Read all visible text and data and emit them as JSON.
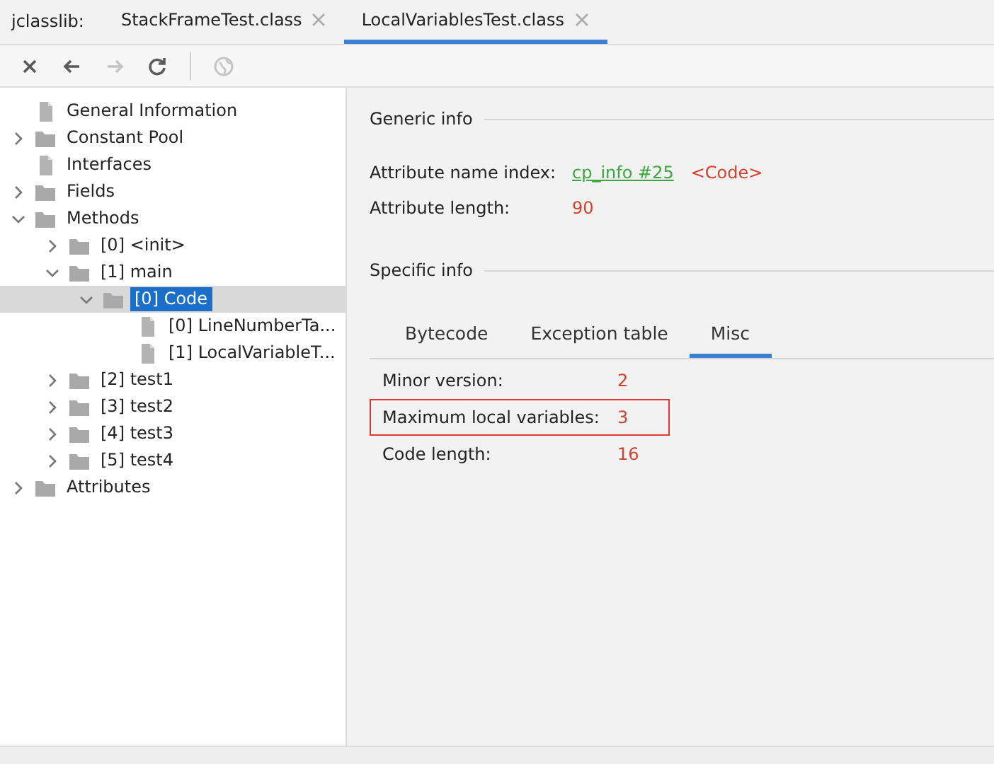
{
  "title_bar": {
    "app_label": "jclasslib:",
    "tabs": [
      {
        "label": "StackFrameTest.class",
        "selected": false
      },
      {
        "label": "LocalVariablesTest.class",
        "selected": true
      }
    ]
  },
  "toolbar": [
    {
      "kind": "close",
      "disabled": false
    },
    {
      "kind": "back",
      "disabled": false
    },
    {
      "kind": "forward",
      "disabled": true
    },
    {
      "kind": "refresh",
      "disabled": false
    },
    {
      "kind": "web",
      "disabled": true
    }
  ],
  "tree": [
    {
      "label": "General Information",
      "kind": "file",
      "selected": false
    },
    {
      "label": "Constant Pool",
      "kind": "folder",
      "expanded": false,
      "selected": false
    },
    {
      "label": "Interfaces",
      "kind": "file",
      "selected": false
    },
    {
      "label": "Fields",
      "kind": "folder",
      "expanded": false,
      "selected": false
    },
    {
      "label": "Methods",
      "kind": "folder",
      "expanded": true,
      "selected": false,
      "children": [
        {
          "label": "[0] <init>",
          "kind": "folder",
          "expanded": false,
          "selected": false
        },
        {
          "label": "[1] main",
          "kind": "folder",
          "expanded": true,
          "selected": false,
          "children": [
            {
              "label": "[0] Code",
              "kind": "folder",
              "expanded": true,
              "selected": true,
              "children": [
                {
                  "label": "[0] LineNumberTa...",
                  "kind": "file",
                  "selected": false
                },
                {
                  "label": "[1] LocalVariableT...",
                  "kind": "file",
                  "selected": false
                }
              ]
            }
          ]
        },
        {
          "label": "[2] test1",
          "kind": "folder",
          "expanded": false,
          "selected": false
        },
        {
          "label": "[3] test2",
          "kind": "folder",
          "expanded": false,
          "selected": false
        },
        {
          "label": "[4] test3",
          "kind": "folder",
          "expanded": false,
          "selected": false
        },
        {
          "label": "[5] test4",
          "kind": "folder",
          "expanded": false,
          "selected": false
        }
      ]
    },
    {
      "label": "Attributes",
      "kind": "folder",
      "expanded": false,
      "selected": false
    }
  ],
  "generic_info": {
    "heading": "Generic info",
    "rows": [
      {
        "label": "Attribute name index:",
        "link": "cp_info #25",
        "value": "<Code>"
      },
      {
        "label": "Attribute length:",
        "value": "90"
      }
    ]
  },
  "specific_info": {
    "heading": "Specific info",
    "tabs": [
      {
        "label": "Bytecode",
        "selected": false
      },
      {
        "label": "Exception table",
        "selected": false
      },
      {
        "label": "Misc",
        "selected": true
      }
    ],
    "rows": [
      {
        "label": "Minor version:",
        "value": "2",
        "highlighted": false
      },
      {
        "label": "Maximum local variables:",
        "value": "3",
        "highlighted": true
      },
      {
        "label": "Code length:",
        "value": "16",
        "highlighted": false
      }
    ]
  }
}
